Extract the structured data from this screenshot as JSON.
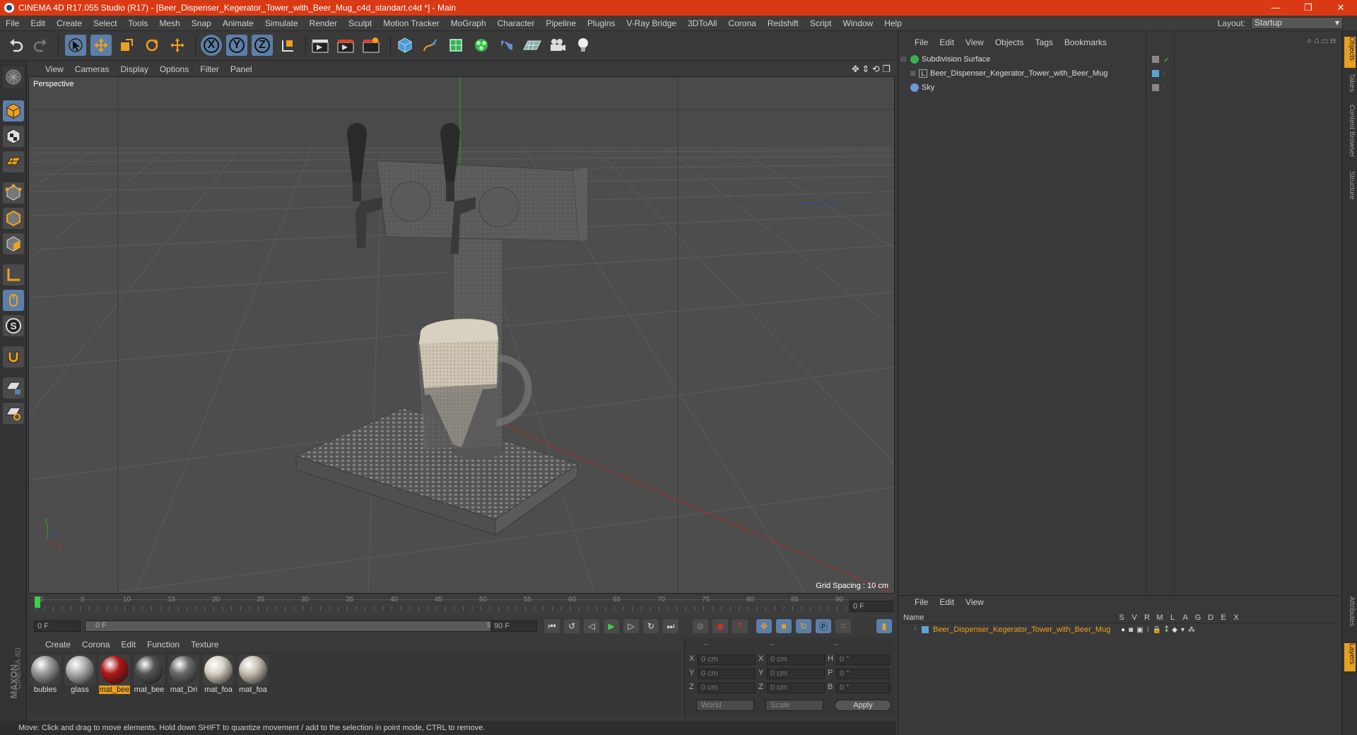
{
  "window": {
    "title": "CINEMA 4D R17.055 Studio (R17) - [Beer_Dispenser_Kegerator_Tower_with_Beer_Mug_c4d_standart.c4d *] - Main",
    "minimize": "—",
    "restore": "❐",
    "close": "✕"
  },
  "menubar": {
    "items": [
      "File",
      "Edit",
      "Create",
      "Select",
      "Tools",
      "Mesh",
      "Snap",
      "Animate",
      "Simulate",
      "Render",
      "Sculpt",
      "Motion Tracker",
      "MoGraph",
      "Character",
      "Pipeline",
      "Plugins",
      "V-Ray Bridge",
      "3DToAll",
      "Corona",
      "Redshift",
      "Script",
      "Window",
      "Help"
    ],
    "layout_label": "Layout:",
    "layout_value": "Startup"
  },
  "toolbar": {
    "x_label": "X",
    "y_label": "Y",
    "z_label": "Z"
  },
  "viewport": {
    "menu": [
      "View",
      "Cameras",
      "Display",
      "Options",
      "Filter",
      "Panel"
    ],
    "camera_label": "Perspective",
    "grid_spacing": "Grid Spacing : 10 cm"
  },
  "timeline": {
    "ticks": [
      "0",
      "5",
      "10",
      "15",
      "20",
      "25",
      "30",
      "35",
      "40",
      "45",
      "50",
      "55",
      "60",
      "65",
      "70",
      "75",
      "80",
      "85",
      "90"
    ],
    "current_frame": "0 F",
    "start_frame": "0 F",
    "range_start": "0 F",
    "range_end": "90 F",
    "end_frame": "90 F",
    "progress": 0
  },
  "materials": {
    "menu": [
      "Create",
      "Corona",
      "Edit",
      "Function",
      "Texture"
    ],
    "items": [
      {
        "label": "bubles",
        "color": "#9a9a9a"
      },
      {
        "label": "glass",
        "color": "#b0b0b0"
      },
      {
        "label": "mat_bee",
        "color": "#b01818"
      },
      {
        "label": "mat_bee",
        "color": "#555555"
      },
      {
        "label": "mat_Dri",
        "color": "#6a6a6a"
      },
      {
        "label": "mat_foa",
        "color": "#d8d0c4"
      },
      {
        "label": "mat_foa",
        "color": "#c8c0b4"
      }
    ]
  },
  "coordinates": {
    "header": [
      "--",
      "--",
      "--"
    ],
    "rows": [
      {
        "a": "X",
        "av": "0 cm",
        "b": "X",
        "bv": "0 cm",
        "c": "H",
        "cv": "0 °"
      },
      {
        "a": "Y",
        "av": "0 cm",
        "b": "Y",
        "bv": "0 cm",
        "c": "P",
        "cv": "0 °"
      },
      {
        "a": "Z",
        "av": "0 cm",
        "b": "Z",
        "bv": "0 cm",
        "c": "B",
        "cv": "0 °"
      }
    ],
    "mode1": "World",
    "mode2": "Scale",
    "apply": "Apply"
  },
  "status": "Move: Click and drag to move elements. Hold down SHIFT to quantize movement / add to the selection in point mode, CTRL to remove.",
  "objects": {
    "menu": [
      "File",
      "Edit",
      "View",
      "Objects",
      "Tags",
      "Bookmarks"
    ],
    "items": [
      {
        "name": "Subdivision Surface",
        "indent": 0
      },
      {
        "name": "Beer_Dispenser_Kegerator_Tower_with_Beer_Mug",
        "indent": 1
      },
      {
        "name": "Sky",
        "indent": 0
      }
    ]
  },
  "layers": {
    "menu": [
      "File",
      "Edit",
      "View"
    ],
    "header_name": "Name",
    "header_cols": [
      "S",
      "V",
      "R",
      "M",
      "L",
      "A",
      "G",
      "D",
      "E",
      "X"
    ],
    "items": [
      {
        "name": "Beer_Dispenser_Kegerator_Tower_with_Beer_Mug",
        "color": "#5ba3d8"
      }
    ]
  },
  "side_tabs": [
    "Objects",
    "Takes",
    "Content Browser",
    "Structure"
  ],
  "side_tabs_bottom": [
    "Attributes",
    "Layers"
  ],
  "brand": [
    "MAXON",
    "CINEMA 4D"
  ],
  "colors": {
    "accent": "#d93a15",
    "selection": "#5c7fa8",
    "highlight": "#e8a020"
  }
}
